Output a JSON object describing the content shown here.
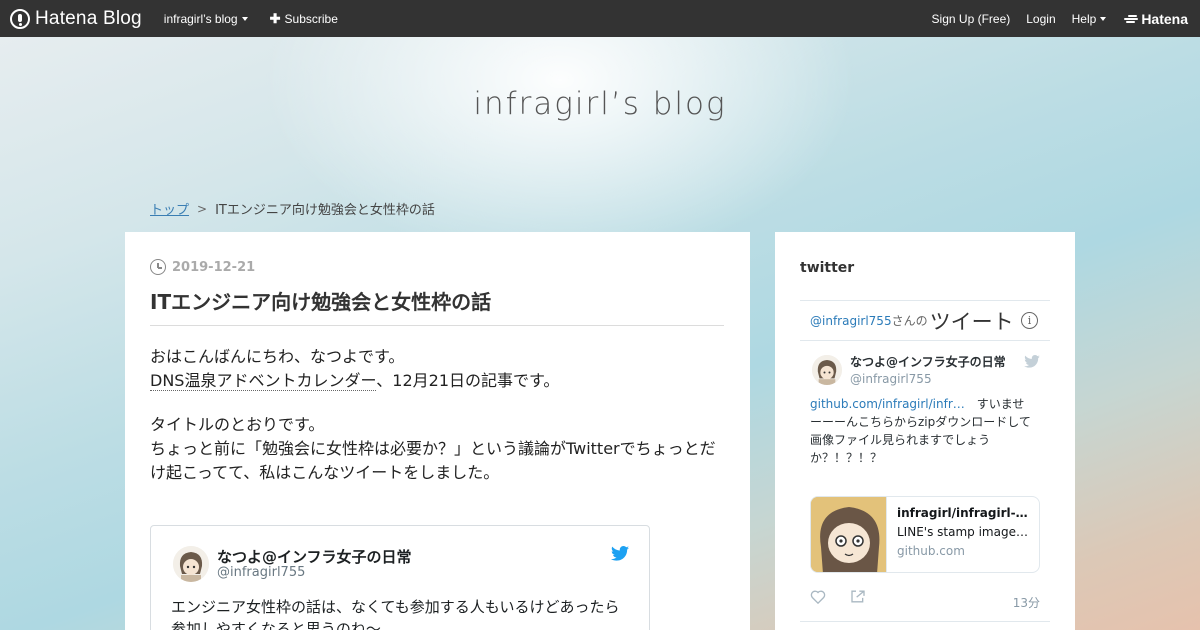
{
  "topbar": {
    "brand": "Hatena Blog",
    "blog_menu": "infragirl’s blog",
    "subscribe": "Subscribe",
    "signup": "Sign Up (Free)",
    "login": "Login",
    "help": "Help",
    "hatena": "Hatena"
  },
  "blog": {
    "title": "infragirl’s blog"
  },
  "breadcrumb": {
    "top": "トップ",
    "separator": ">",
    "current": "ITエンジニア向け勉強会と女性枠の話"
  },
  "article": {
    "date": "2019-12-21",
    "title": "ITエンジニア向け勉強会と女性枠の話",
    "p1_line1": "おはこんばんにちわ、なつよです。",
    "p1_line2_link": "DNS温泉アドベントカレンダー",
    "p1_line2_rest": "、12月21日の記事です。",
    "p2_line1": "タイトルのとおりです。",
    "p2_line2": "ちょっと前に「勉強会に女性枠は必要か？」という議論がTwitterでちょっとだけ起こってて、私はこんなツイートをしました。",
    "embed": {
      "name": "なつよ@インフラ女子の日常",
      "handle": "@infragirl755",
      "text": "エンジニア女性枠の話は、なくても参加する人もいるけどあったら参加しやすくなると思うのね〜"
    }
  },
  "sidebar": {
    "title": "twitter",
    "timeline": {
      "handle": "@infragirl755",
      "san": "さんの",
      "tweets": "ツイート",
      "info": "i",
      "tweet": {
        "name": "なつよ@インフラ女子の日常",
        "user": "@infragirl755",
        "link": "github.com/infragirl/infr…",
        "text": "　すいませーーーんこちらからzipダウンロードして画像ファイル見られますでしょうか？！？！？",
        "card": {
          "title": "infragirl/infragirl-dail…",
          "desc": "LINE's stamp image. …",
          "domain": "github.com"
        },
        "time": "13分"
      }
    }
  },
  "colors": {
    "topbar": "#333333",
    "link": "#3a7eb3",
    "twitter_blue": "#1da1f2"
  }
}
